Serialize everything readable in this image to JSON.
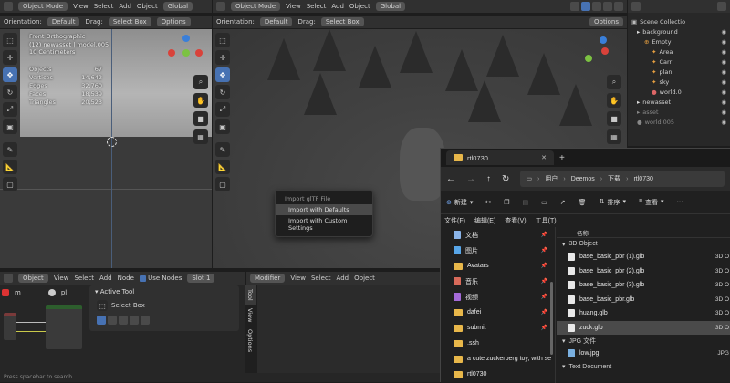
{
  "left_viewport": {
    "mode": "Object Mode",
    "view": "View",
    "select": "Select",
    "add": "Add",
    "object": "Object",
    "transform": "Global",
    "orientation_label": "Orientation:",
    "orientation": "Default",
    "drag_label": "Drag:",
    "drag": "Select Box",
    "overlay": {
      "title": "Front Orthographic",
      "collection": "(12) newasset | model.005",
      "scale": "10 Centimeters"
    },
    "stats": [
      {
        "label": "Objects",
        "value": "67"
      },
      {
        "label": "Vertices",
        "value": "14,642"
      },
      {
        "label": "Edges",
        "value": "32,760"
      },
      {
        "label": "Faces",
        "value": "18,539"
      },
      {
        "label": "Triangles",
        "value": "20,523"
      }
    ]
  },
  "main_viewport": {
    "mode": "Object Mode",
    "view": "View",
    "select": "Select",
    "add": "Add",
    "object": "Object",
    "transform": "Global",
    "orientation_label": "Orientation:",
    "orientation": "Default",
    "drag_label": "Drag:",
    "drag": "Select Box",
    "options": "Options"
  },
  "left_options": "Options",
  "context_menu": {
    "title": "Import glTF File",
    "items": [
      "Import with Defaults",
      "Import with Custom Settings"
    ]
  },
  "outliner": {
    "title": "Scene Collectio",
    "rows": [
      {
        "label": "background",
        "indent": 1
      },
      {
        "label": "Empty",
        "indent": 2
      },
      {
        "label": "Area",
        "indent": 3
      },
      {
        "label": "Carr",
        "indent": 3
      },
      {
        "label": "plan",
        "indent": 3
      },
      {
        "label": "sky",
        "indent": 3
      },
      {
        "label": "world.0",
        "indent": 3
      },
      {
        "label": "newasset",
        "indent": 1
      },
      {
        "label": "asset",
        "indent": 1
      },
      {
        "label": "world.005",
        "indent": 1
      }
    ]
  },
  "node_editor": {
    "object_menu": "Object",
    "view": "View",
    "select": "Select",
    "add": "Add",
    "node": "Node",
    "use_nodes": "Use Nodes",
    "slot": "Slot 1",
    "pl": "pl",
    "search_hint": "Press spacebar to search..."
  },
  "properties": {
    "modifier": "Modifier",
    "view": "View",
    "select": "Select",
    "add": "Add",
    "object": "Object",
    "active_tool": "Active Tool",
    "select_box": "Select Box",
    "tabs": [
      "Tool",
      "View",
      "Options"
    ]
  },
  "explorer": {
    "tab_title": "rtl0730",
    "path": [
      "用户",
      "Deemos",
      "下载",
      "rtl0730"
    ],
    "new_label": "新建",
    "sort_label": "排序",
    "view_label": "查看",
    "menu": [
      "文件(F)",
      "编辑(E)",
      "查看(V)",
      "工具(T)"
    ],
    "column_name": "名称",
    "nav": [
      "文档",
      "图片",
      "Avatars",
      "音乐",
      "视频",
      "dafei",
      "submit",
      ".ssh",
      "a cute zuckerberg toy, with se",
      "rtl0730"
    ],
    "groups": [
      {
        "name": "3D Object",
        "files": [
          "base_basic_pbr (1).glb",
          "base_basic_pbr (2).glb",
          "base_basic_pbr (3).glb",
          "base_basic_pbr.glb",
          "huang.glb",
          "zuck.glb"
        ],
        "type": "3D O"
      },
      {
        "name": "JPG 文件",
        "files": [
          "low.jpg"
        ],
        "type": "JPG"
      },
      {
        "name": "Text Document",
        "files": [],
        "type": ""
      }
    ]
  },
  "colors": {
    "accent": "#4772b3",
    "folder": "#e8b74a",
    "highlight": "#4a4a4a"
  }
}
